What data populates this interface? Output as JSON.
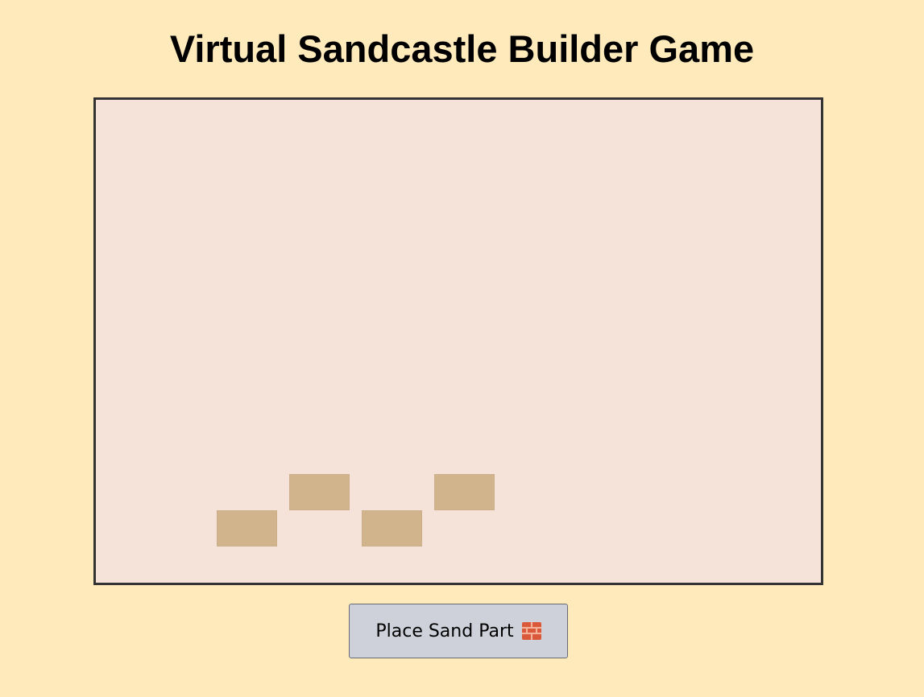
{
  "game": {
    "title": "Virtual Sandcastle Builder Game",
    "place_button_label": "Place Sand Part",
    "place_button_icon": "brick-icon",
    "colors": {
      "background": "#ffeabb",
      "board": "#f5e3da",
      "board_border": "#333333",
      "sand_block": "#d2b48c",
      "button": "#ced1d9"
    },
    "placed_sand_parts": 4
  }
}
